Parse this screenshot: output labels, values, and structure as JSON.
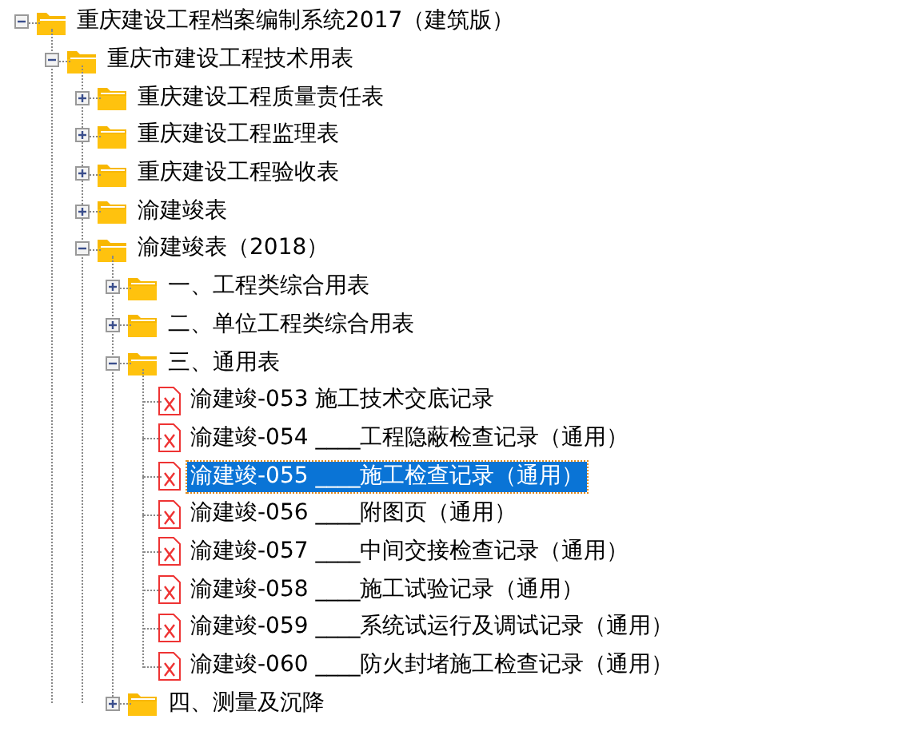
{
  "tree": [
    {
      "kind": "folder",
      "label": "重庆建设工程档案编制系统2017（建筑版）",
      "expanded": true,
      "children": [
        {
          "kind": "folder",
          "label": "重庆市建设工程技术用表",
          "expanded": true,
          "children": [
            {
              "kind": "folder",
              "label": "重庆建设工程质量责任表",
              "expanded": false
            },
            {
              "kind": "folder",
              "label": "重庆建设工程监理表",
              "expanded": false
            },
            {
              "kind": "folder",
              "label": "重庆建设工程验收表",
              "expanded": false
            },
            {
              "kind": "folder",
              "label": "渝建竣表",
              "expanded": false
            },
            {
              "kind": "folder",
              "label": "渝建竣表（2018）",
              "expanded": true,
              "children": [
                {
                  "kind": "folder",
                  "label": "一、工程类综合用表",
                  "expanded": false
                },
                {
                  "kind": "folder",
                  "label": "二、单位工程类综合用表",
                  "expanded": false
                },
                {
                  "kind": "folder",
                  "label": "三、通用表",
                  "expanded": true,
                  "children": [
                    {
                      "kind": "file",
                      "label": "渝建竣-053 施工技术交底记录",
                      "selected": false
                    },
                    {
                      "kind": "file",
                      "label": "渝建竣-054 ____工程隐蔽检查记录（通用）",
                      "selected": false
                    },
                    {
                      "kind": "file",
                      "label": "渝建竣-055 ____施工检查记录（通用）",
                      "selected": true
                    },
                    {
                      "kind": "file",
                      "label": "渝建竣-056 ____附图页（通用）",
                      "selected": false
                    },
                    {
                      "kind": "file",
                      "label": "渝建竣-057 ____中间交接检查记录（通用）",
                      "selected": false
                    },
                    {
                      "kind": "file",
                      "label": "渝建竣-058 ____施工试验记录（通用）",
                      "selected": false
                    },
                    {
                      "kind": "file",
                      "label": "渝建竣-059 ____系统试运行及调试记录（通用）",
                      "selected": false
                    },
                    {
                      "kind": "file",
                      "label": "渝建竣-060 ____防火封堵施工检查记录（通用）",
                      "selected": false
                    }
                  ]
                },
                {
                  "kind": "folder",
                  "label": "四、测量及沉降",
                  "expanded": false
                }
              ]
            }
          ]
        }
      ]
    }
  ]
}
